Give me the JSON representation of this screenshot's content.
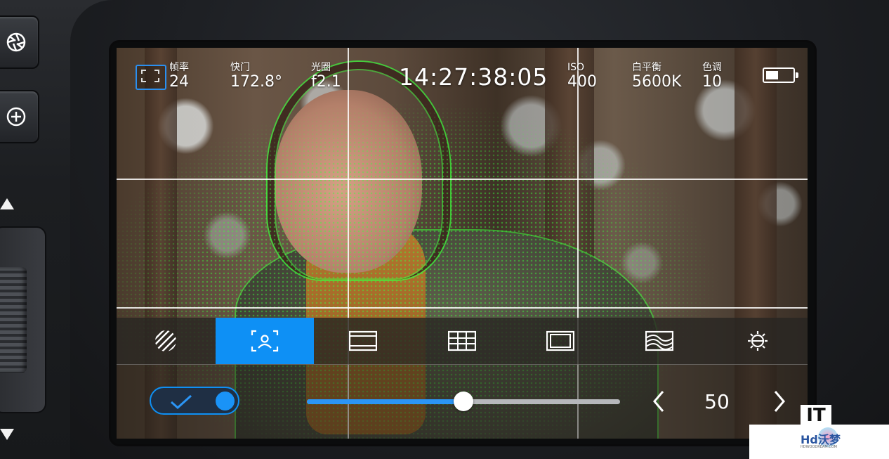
{
  "status_bar": {
    "frame_rate": {
      "label": "帧率",
      "value": "24"
    },
    "shutter": {
      "label": "快门",
      "value": "172.8°"
    },
    "iris": {
      "label": "光圈",
      "value": "f2.1"
    },
    "timecode": "14:27:38:05",
    "iso": {
      "label": "ISO",
      "value": "400"
    },
    "white_balance": {
      "label": "白平衡",
      "value": "5600K"
    },
    "tint": {
      "label": "色调",
      "value": "10"
    },
    "battery_level": 0.45
  },
  "toolbar": {
    "tools": [
      {
        "icon": "zebra-icon",
        "active": false
      },
      {
        "icon": "focus-assist-icon",
        "active": true
      },
      {
        "icon": "frame-guides-icon",
        "active": false
      },
      {
        "icon": "grid-icon",
        "active": false
      },
      {
        "icon": "safe-area-icon",
        "active": false
      },
      {
        "icon": "false-color-icon",
        "active": false
      },
      {
        "icon": "exposure-icon",
        "active": false
      }
    ]
  },
  "controls": {
    "toggle_on": true,
    "slider_value": 50,
    "slider_max": 100,
    "value_display": "50"
  },
  "colors": {
    "accent": "#0e90f5",
    "focus_peaking": "#3cff3c"
  },
  "watermark": {
    "logo": "IT",
    "brand": "Hd沃梦",
    "sub": "HDWOODREAM.COM"
  }
}
